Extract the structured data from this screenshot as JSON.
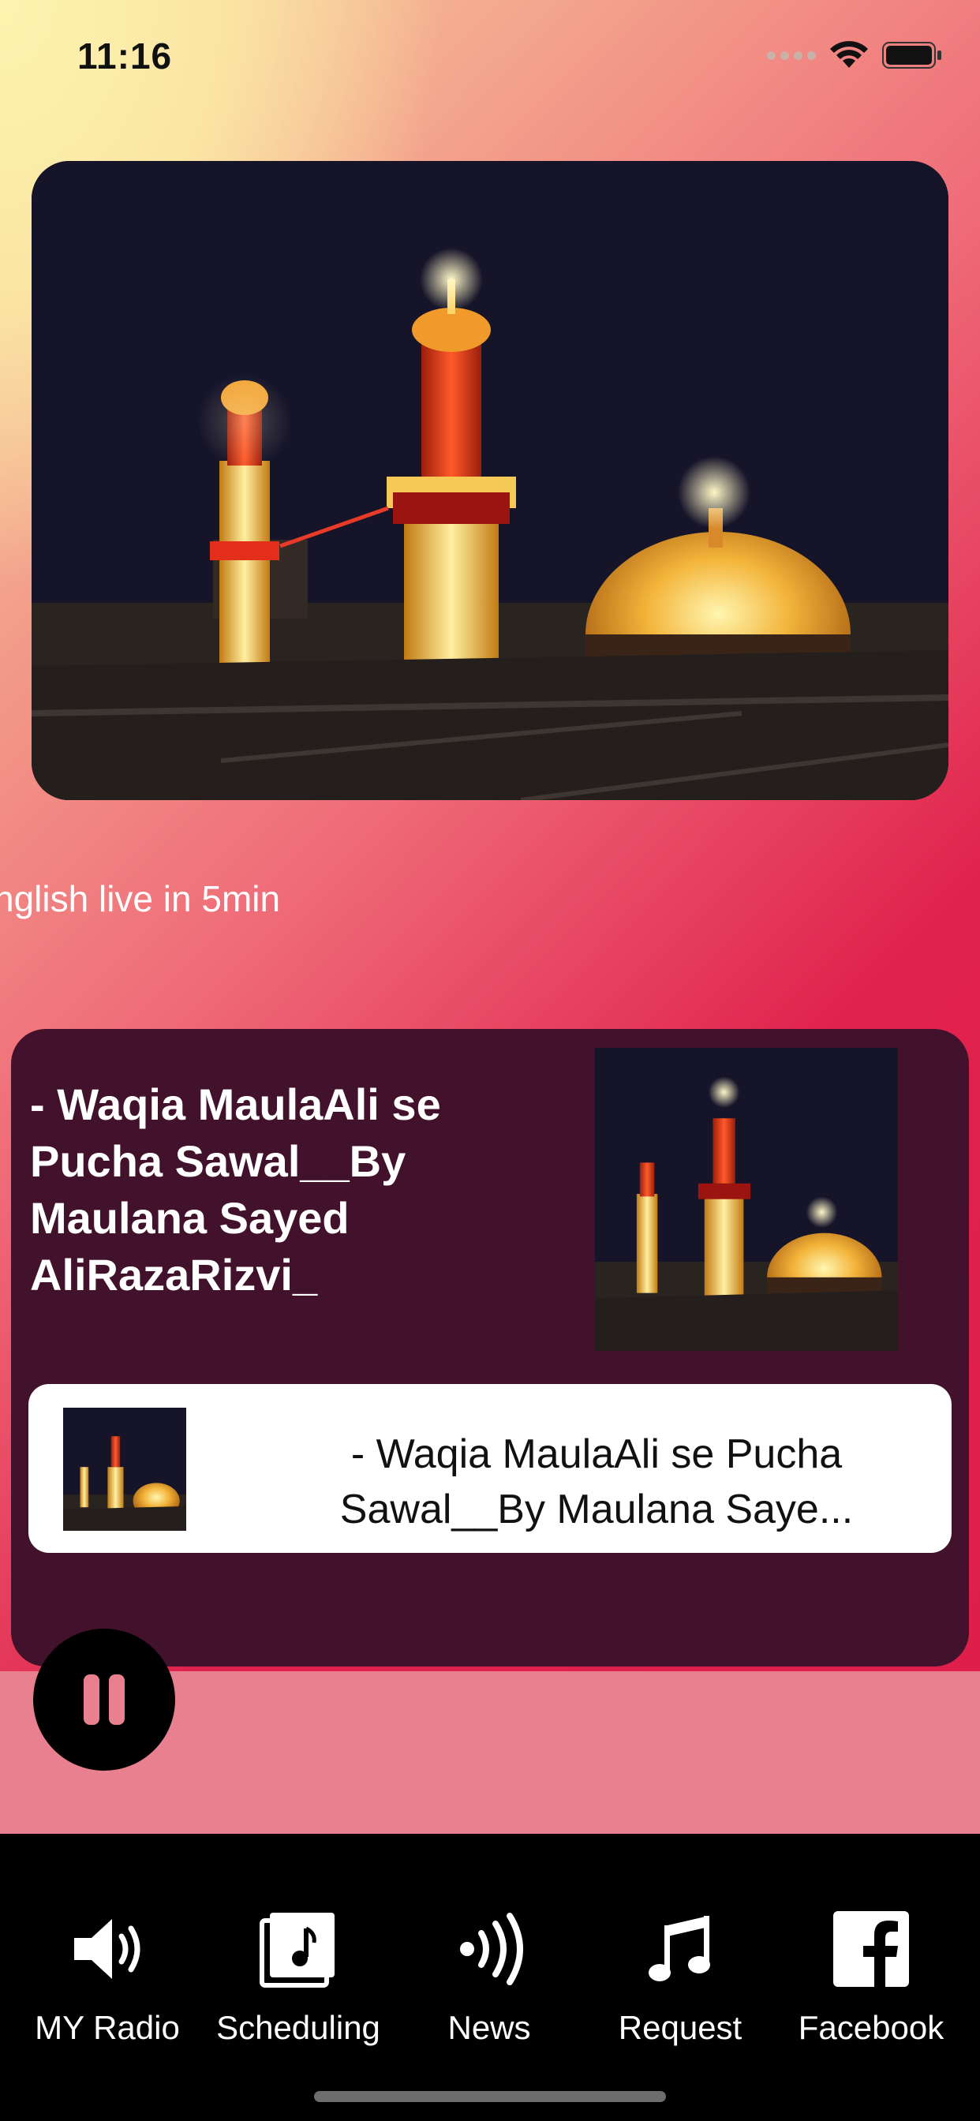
{
  "status_bar": {
    "time": "11:16"
  },
  "ticker": {
    "text": "nglish live in 5min"
  },
  "player": {
    "title": "- Waqia MaulaAli se Pucha Sawal__By Maulana Sayed AliRazaRizvi_",
    "now_playing": "- Waqia MaulaAli se Pucha Sawal__By Maulana Saye..."
  },
  "tabs": [
    {
      "label": "MY Radio",
      "icon": "speaker-icon"
    },
    {
      "label": "Scheduling",
      "icon": "music-note-icon"
    },
    {
      "label": "News",
      "icon": "broadcast-icon"
    },
    {
      "label": "Request",
      "icon": "music-notes-icon"
    },
    {
      "label": "Facebook",
      "icon": "facebook-icon"
    }
  ],
  "colors": {
    "accent": "#e0234d",
    "card": "#42112b",
    "tab_bar": "#000000",
    "player_bg": "#e8808f"
  }
}
